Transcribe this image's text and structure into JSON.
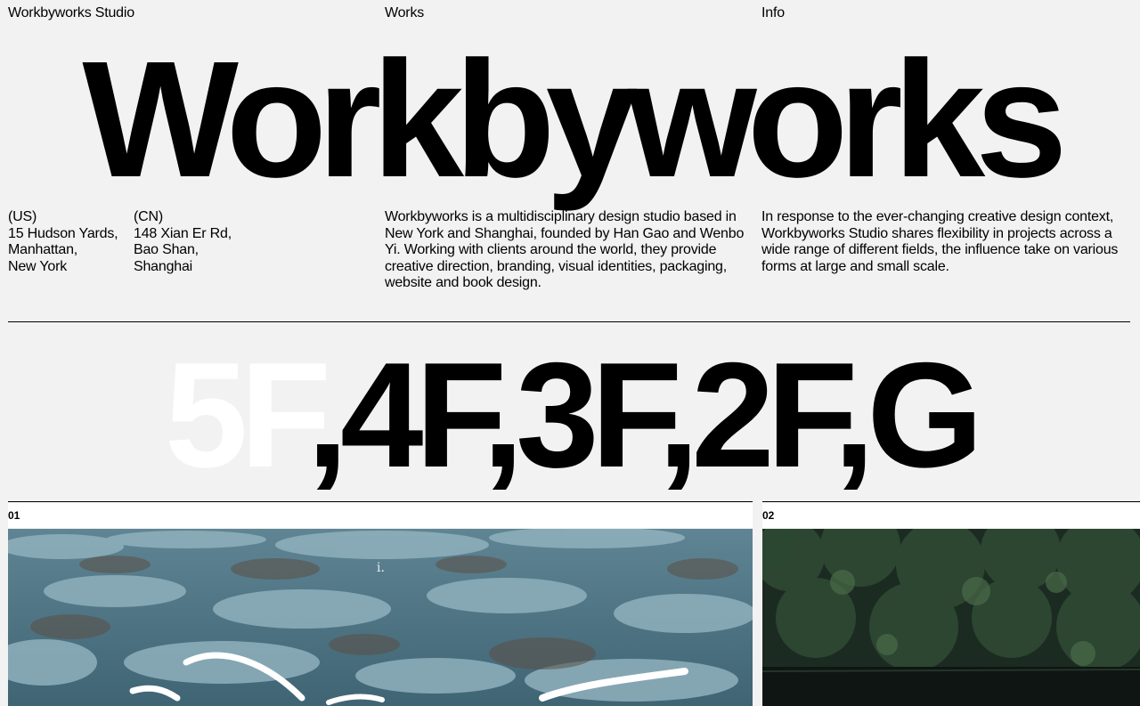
{
  "nav": {
    "studio": "Workbyworks Studio",
    "works": "Works",
    "info": "Info"
  },
  "hero": {
    "title": "Workbyworks"
  },
  "addresses": [
    {
      "country": "(US)",
      "lines": [
        "15 Hudson Yards,",
        "Manhattan,",
        "New York"
      ]
    },
    {
      "country": "(CN)",
      "lines": [
        "148 Xian Er Rd,",
        "Bao Shan,",
        "Shanghai"
      ]
    }
  ],
  "about": "Workbyworks is a multidisciplinary design studio based in New York and Shanghai, founded by Han Gao and Wenbo Yi.  Working with clients around the world, they provide creative direction, branding, visual identities, packaging, website and book design.",
  "response": "In response to the ever-changing creative design context, Workbyworks Studio shares flexibility in projects across a wide range of different fields, the influence take on various forms at large and small scale.",
  "floors": {
    "items": [
      "5F",
      "4F",
      "3F",
      "2F",
      "G"
    ],
    "separator": ",",
    "active": "5F",
    "active_color": "#ffffff"
  },
  "projects": [
    {
      "number": "01",
      "caption": "i.",
      "image": "water-surface-image"
    },
    {
      "number": "02",
      "image": "foliage-pond-image"
    }
  ]
}
